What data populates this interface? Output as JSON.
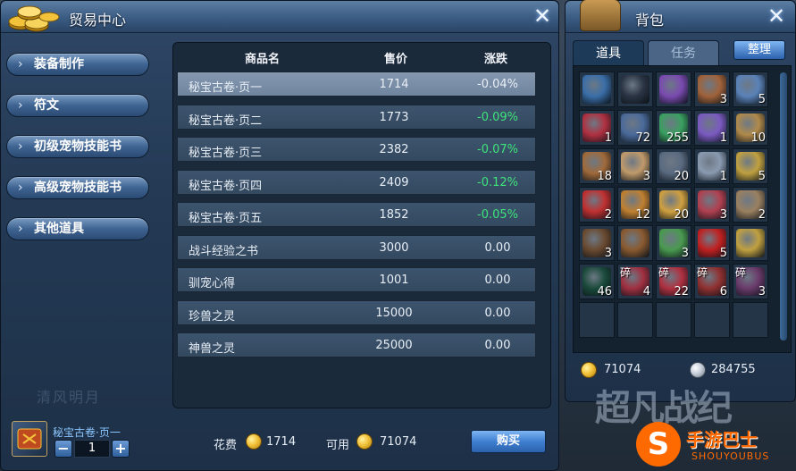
{
  "trade": {
    "title": "贸易中心",
    "close": "✕",
    "nav": [
      {
        "chev": "›",
        "label": "装备制作"
      },
      {
        "chev": "›",
        "label": "符文"
      },
      {
        "chev": "›",
        "label": "初级宠物技能书"
      },
      {
        "chev": "›",
        "label": "高级宠物技能书"
      },
      {
        "chev": "›",
        "label": "其他道具"
      }
    ],
    "table": {
      "headers": {
        "name": "商品名",
        "price": "售价",
        "change": "涨跌"
      },
      "rows": [
        {
          "name": "秘宝古卷·页一",
          "price": "1714",
          "change": "-0.04%"
        },
        {
          "name": "秘宝古卷·页二",
          "price": "1773",
          "change": "-0.09%"
        },
        {
          "name": "秘宝古卷·页三",
          "price": "2382",
          "change": "-0.07%"
        },
        {
          "name": "秘宝古卷·页四",
          "price": "2409",
          "change": "-0.12%"
        },
        {
          "name": "秘宝古卷·页五",
          "price": "1852",
          "change": "-0.05%"
        },
        {
          "name": "战斗经验之书",
          "price": "3000",
          "change": "0.00"
        },
        {
          "name": "驯宠心得",
          "price": "1001",
          "change": "0.00"
        },
        {
          "name": "珍兽之灵",
          "price": "15000",
          "change": "0.00"
        },
        {
          "name": "神兽之灵",
          "price": "25000",
          "change": "0.00"
        }
      ]
    },
    "selected_item_name": "秘宝古卷·页一",
    "quantity": "1",
    "minus": "−",
    "plus": "+",
    "cost_label": "花费",
    "cost_value": "1714",
    "avail_label": "可用",
    "avail_value": "71074",
    "buy_label": "购买"
  },
  "bag": {
    "title": "背包",
    "close": "✕",
    "tabs": [
      "道具",
      "任务"
    ],
    "sort_label": "整理",
    "slots": [
      {
        "c": "",
        "f": "",
        "color": "#3a6ea8"
      },
      {
        "c": "",
        "f": "",
        "color": "#2a3444"
      },
      {
        "c": "",
        "f": "",
        "color": "#7a4ab0"
      },
      {
        "c": "3",
        "f": "",
        "color": "#a0623a"
      },
      {
        "c": "5",
        "f": "",
        "color": "#5a82b8"
      },
      {
        "c": "1",
        "f": "",
        "color": "#b03040"
      },
      {
        "c": "72",
        "f": "",
        "color": "#4a6a9a"
      },
      {
        "c": "255",
        "f": "",
        "color": "#3aa060"
      },
      {
        "c": "1",
        "f": "",
        "color": "#7a5ac0"
      },
      {
        "c": "10",
        "f": "",
        "color": "#b08a4a"
      },
      {
        "c": "18",
        "f": "",
        "color": "#a06a3a"
      },
      {
        "c": "3",
        "f": "",
        "color": "#c09a6a"
      },
      {
        "c": "20",
        "f": "",
        "color": "#5a6a80"
      },
      {
        "c": "1",
        "f": "",
        "color": "#8a9ab0"
      },
      {
        "c": "5",
        "f": "",
        "color": "#c0a040"
      },
      {
        "c": "2",
        "f": "",
        "color": "#c03030"
      },
      {
        "c": "12",
        "f": "",
        "color": "#c08030"
      },
      {
        "c": "20",
        "f": "",
        "color": "#d0a040"
      },
      {
        "c": "3",
        "f": "",
        "color": "#b04050"
      },
      {
        "c": "2",
        "f": "",
        "color": "#9a8060"
      },
      {
        "c": "3",
        "f": "",
        "color": "#6a4a30"
      },
      {
        "c": "",
        "f": "",
        "color": "#8a5a30"
      },
      {
        "c": "3",
        "f": "",
        "color": "#4a9a50"
      },
      {
        "c": "5",
        "f": "",
        "color": "#c02020"
      },
      {
        "c": "",
        "f": "",
        "color": "#c0a040"
      },
      {
        "c": "46",
        "f": "",
        "color": "#1a4a3a"
      },
      {
        "c": "4",
        "f": "碎",
        "color": "#a03040"
      },
      {
        "c": "22",
        "f": "碎",
        "color": "#b03040"
      },
      {
        "c": "6",
        "f": "碎",
        "color": "#903030"
      },
      {
        "c": "3",
        "f": "碎",
        "color": "#6a3a6a"
      }
    ],
    "gold": "71074",
    "silver": "284755"
  },
  "watermark": {
    "left_art_1": "清风明月",
    "game_title": "超凡战纪",
    "logo_glyph": "S",
    "logo_text": "手游巴士",
    "logo_sub": "SHOUYOUBUS"
  },
  "colors": {
    "gain": "#3ee37a",
    "neutral": "#e8eef5"
  }
}
